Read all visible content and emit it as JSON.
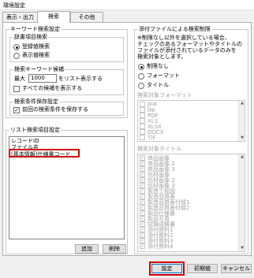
{
  "window": {
    "title": "環境設定"
  },
  "tabs": [
    "表示・出力",
    "検索",
    "その他"
  ],
  "keyword_settings": {
    "title": "キーワード検索設定",
    "dictionary": {
      "title": "辞書項目検索",
      "options": [
        "登録値検索",
        "表示値検索"
      ],
      "selected": 0
    },
    "candidates": {
      "title": "検索キーワード候補",
      "max_label": "最大",
      "max_value": "1000",
      "suffix": "をリスト表示する",
      "show_all_label": "すべての候補を表示する",
      "show_all_checked": false
    },
    "save_condition": {
      "title": "検索条件保存設定",
      "label": "前回の検索条件を保存する",
      "checked": true
    }
  },
  "list_settings": {
    "title": "リスト検索項目設定",
    "items": [
      "レコードID",
      "ファイル名",
      "[基本情報]仕様書コード"
    ],
    "highlighted_index": 2,
    "add_button": "追加",
    "delete_button": "削除"
  },
  "attachment_limit": {
    "title": "添付ファイルによる検索制限",
    "note": [
      "※制限なし以外を選択している場合、",
      "チェックのあるフォーマットやタイトルの",
      "ファイルが添付されているデータのみを",
      "検索対象とします。"
    ],
    "options": [
      "制限なし",
      "フォーマット",
      "タイトル"
    ],
    "selected": 0,
    "format_list_title": "検索対象フォーマット",
    "formats": [
      "JFIF",
      "INI",
      "PDF",
      "XLS",
      "XLSX",
      "DOCX",
      "TIF"
    ],
    "formats_checked": [
      false,
      false,
      false,
      false,
      false,
      false,
      false
    ],
    "title_list_title": "検索対象タイトル",
    "titles": [
      "商品画像",
      "商品画像 2",
      "商品画像 3",
      "包材画像",
      "包材画像 2",
      "包材画像 3",
      "製造工程図",
      "製造品質表",
      "製造品質表付録1",
      "製造品質表付録2",
      "製品仕様書",
      "製品写真",
      "試験成績書",
      "添付資料1",
      "添付資料2",
      "添付資料3",
      "添付資料4"
    ],
    "titles_checked": true
  },
  "footer": {
    "ok": "設定",
    "init": "初期値",
    "cancel": "キャンセル"
  },
  "colors": {
    "highlight": "#cc0000",
    "accent": "#0078d7"
  }
}
